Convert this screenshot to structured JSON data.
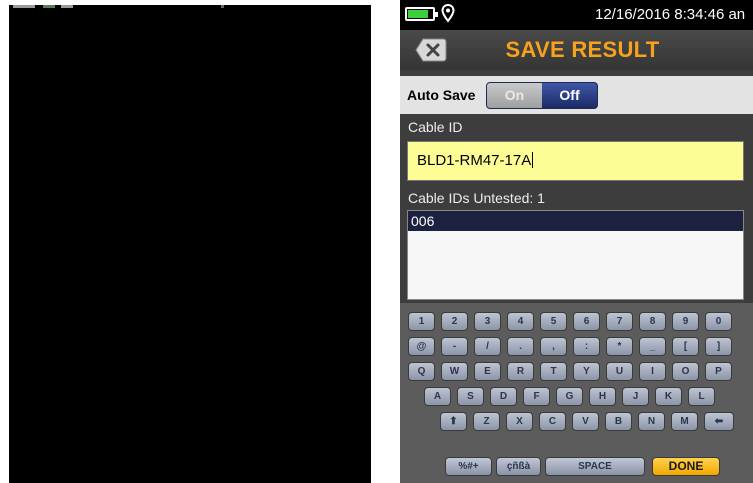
{
  "device": {
    "status": {
      "datetime": "12/16/2016 8:34:46 an"
    },
    "title": "SAVE RESULT",
    "auto_save": {
      "label": "Auto Save",
      "on_label": "On",
      "off_label": "Off",
      "selected": "Off"
    },
    "cable_id": {
      "label": "Cable ID",
      "value": "BLD1-RM47-17A"
    },
    "untested": {
      "label": "Cable IDs Untested: 1",
      "items": [
        "006"
      ]
    },
    "keyboard": {
      "rows": [
        [
          "1",
          "2",
          "3",
          "4",
          "5",
          "6",
          "7",
          "8",
          "9",
          "0"
        ],
        [
          "@",
          "-",
          "/",
          ".",
          ",",
          ":",
          "*",
          "_",
          "[",
          "]"
        ],
        [
          "Q",
          "W",
          "E",
          "R",
          "T",
          "Y",
          "U",
          "I",
          "O",
          "P"
        ],
        [
          "A",
          "S",
          "D",
          "F",
          "G",
          "H",
          "J",
          "K",
          "L"
        ],
        [
          "Z",
          "X",
          "C",
          "V",
          "B",
          "N",
          "M"
        ]
      ],
      "shift_glyph": "⬆",
      "backspace_glyph": "⬅",
      "symbols_label": "%#+",
      "accents_label": "çñßà",
      "space_label": "SPACE",
      "done_label": "DONE"
    }
  }
}
